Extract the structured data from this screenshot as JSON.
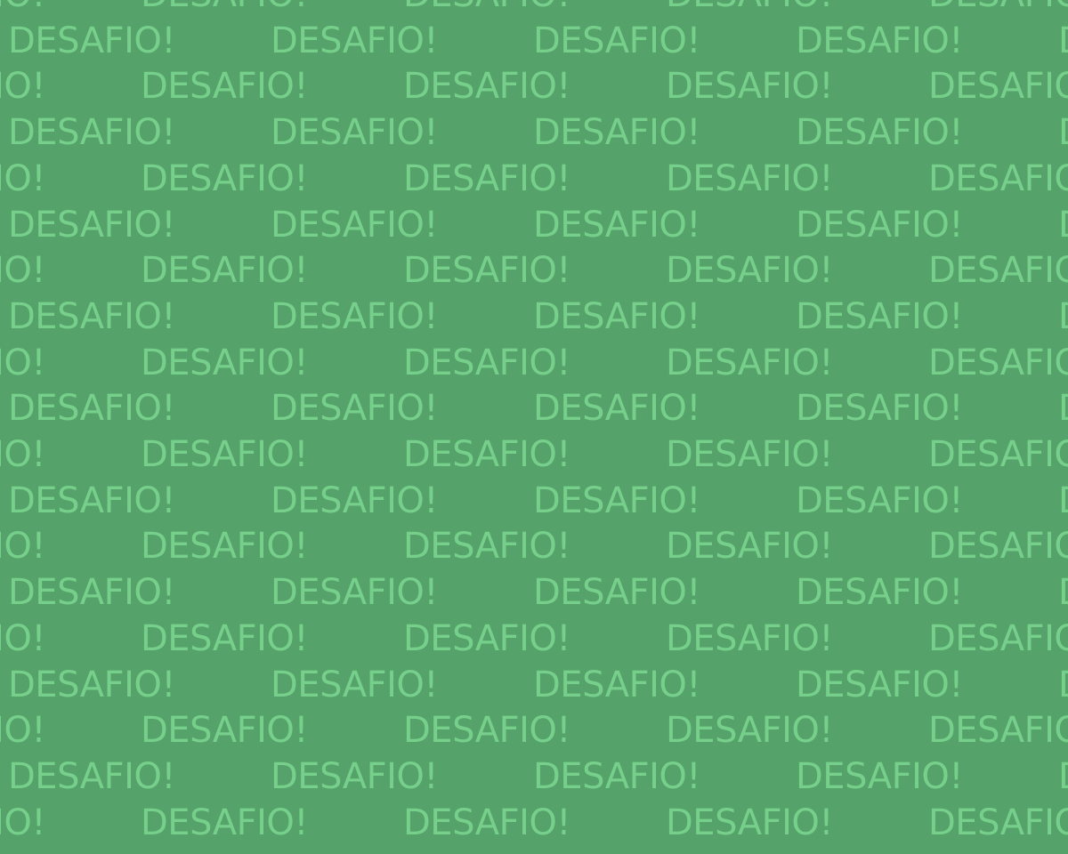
{
  "background": {
    "color": "#55a26a",
    "text_color": "#76cf8a",
    "word": "DESAFIO!"
  }
}
